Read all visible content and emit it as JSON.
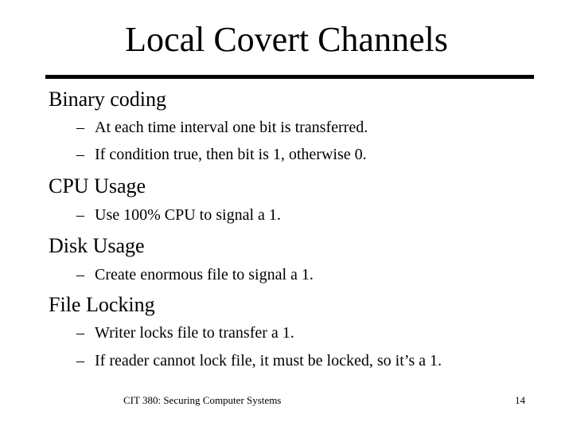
{
  "slide": {
    "title": "Local Covert Channels",
    "bullet_marker": "–",
    "sections": [
      {
        "heading": "Binary coding",
        "items": [
          "At each time interval one bit is transferred.",
          "If condition true, then bit is 1, otherwise 0."
        ]
      },
      {
        "heading": "CPU Usage",
        "items": [
          "Use 100% CPU to signal a 1."
        ]
      },
      {
        "heading": "Disk Usage",
        "items": [
          "Create enormous file to signal a 1."
        ]
      },
      {
        "heading": "File Locking",
        "items": [
          "Writer locks file to transfer a 1.",
          "If reader cannot lock file, it must be locked, so it’s a 1."
        ]
      }
    ]
  },
  "footer": {
    "course": "CIT 380: Securing Computer Systems",
    "page_number": "14"
  }
}
